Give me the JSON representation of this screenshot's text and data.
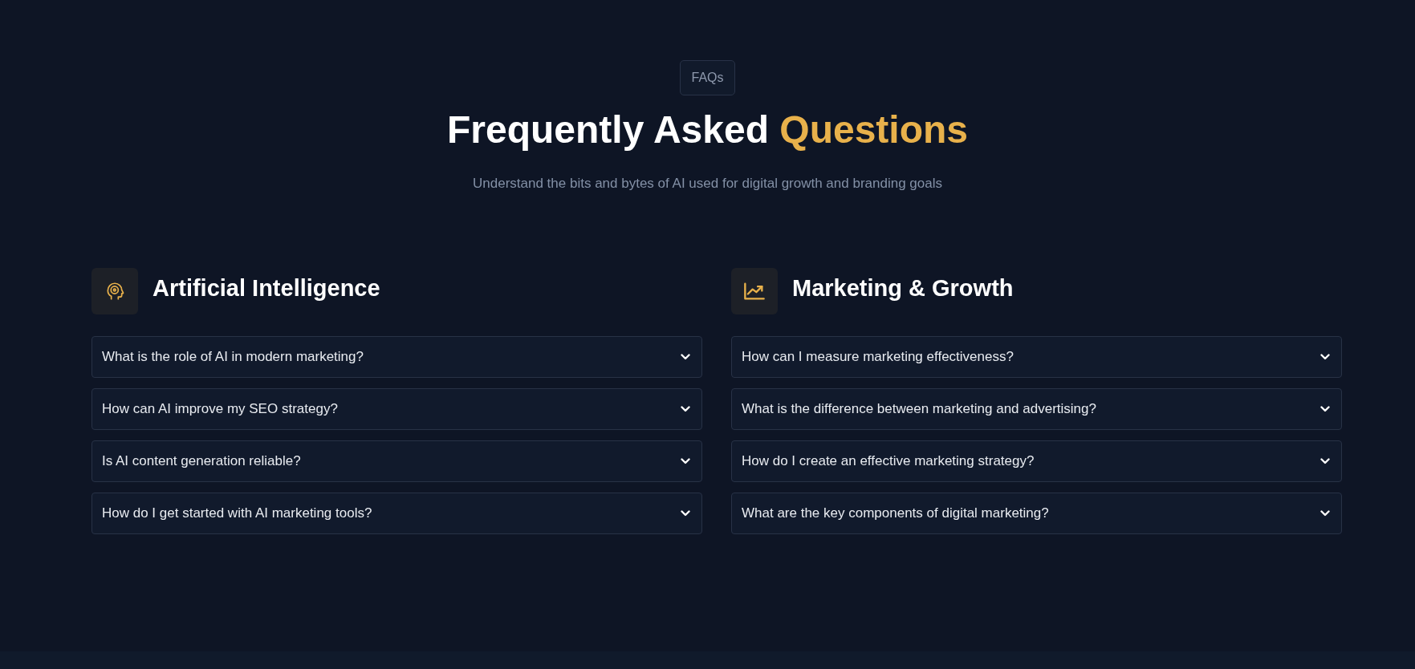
{
  "badge": "FAQs",
  "title": {
    "lead": "Frequently Asked",
    "highlight": "Questions"
  },
  "subtitle": "Understand the bits and bytes of AI used for digital growth and branding goals",
  "categories": [
    {
      "title": "Artificial Intelligence",
      "questions": [
        {
          "text": "What is the role of AI in modern marketing?",
          "expanded": false
        },
        {
          "text": "How can AI improve my SEO strategy?",
          "expanded": false
        },
        {
          "text": "Is AI content generation reliable?",
          "expanded": false
        },
        {
          "text": "How do I get started with AI marketing tools?",
          "expanded": false
        }
      ]
    },
    {
      "title": "Marketing & Growth",
      "questions": [
        {
          "text": "How can I measure marketing effectiveness?",
          "expanded": false
        },
        {
          "text": "What is the difference between marketing and advertising?",
          "expanded": false
        },
        {
          "text": "How do I create an effective marketing strategy?",
          "expanded": false
        },
        {
          "text": "What are the key components of digital marketing?",
          "expanded": false
        }
      ]
    }
  ]
}
